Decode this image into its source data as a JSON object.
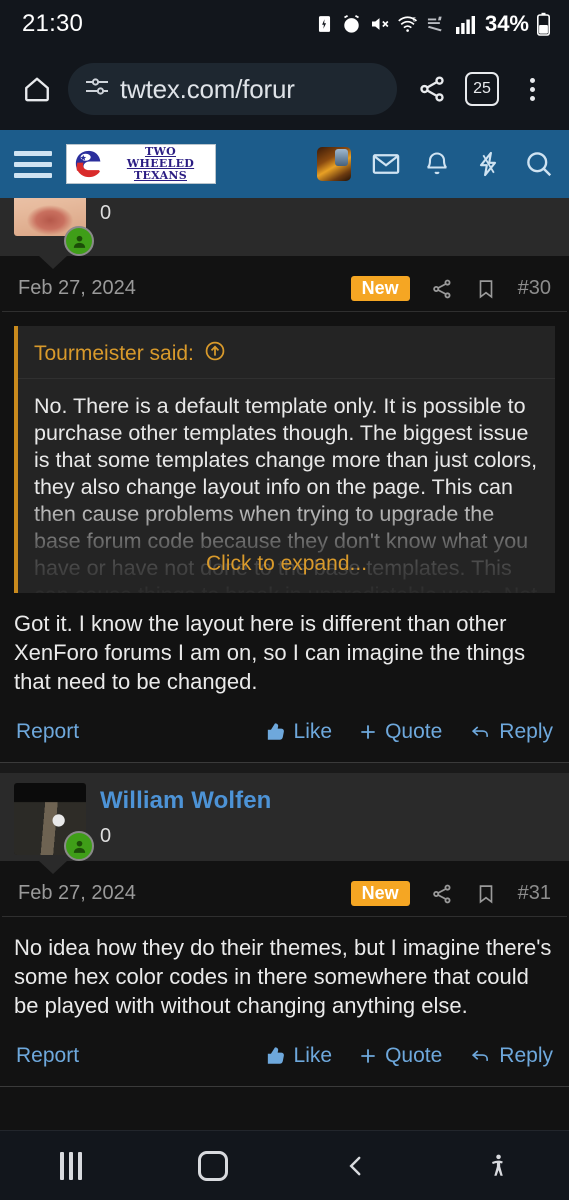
{
  "status_bar": {
    "time": "21:30",
    "battery_percent": "34%",
    "icons": [
      "battery-saver-icon",
      "alarm-icon",
      "mute-icon",
      "wifi-6-icon",
      "mobile-data-icon",
      "signal-bars-icon",
      "battery-icon"
    ]
  },
  "browser": {
    "home_icon": "home-icon",
    "url": "twtex.com/forur",
    "site_settings_icon": "site-settings-icon",
    "share_icon": "share-icon",
    "tab_count": "25",
    "menu_icon": "kebab-menu-icon"
  },
  "forum_header": {
    "menu_icon": "hamburger-menu-icon",
    "logo_line1": "TWO WHEELED",
    "logo_line2": "TEXANS",
    "icons": [
      "user-avatar-icon",
      "inbox-icon",
      "alerts-bell-icon",
      "whats-new-icon",
      "search-icon"
    ]
  },
  "posts": [
    {
      "author": "",
      "reaction_count": "0",
      "date": "Feb 27, 2024",
      "badge": "New",
      "number": "#30",
      "share_icon": "share-icon",
      "bookmark_icon": "bookmark-icon",
      "quote": {
        "header": "Tourmeister said:",
        "jump_icon": "jump-to-post-icon",
        "text": "No. There is a default template only. It is possible to purchase other templates though. The biggest issue is that some templates change more than just colors, they also change layout info on the page. This can then cause problems when trying to upgrade the base forum code because they don't know what you have or have not done to the base templates. This can cause things to break in unpredictable ways. Not being a coder myself, I have",
        "expand_label": "Click to expand..."
      },
      "body": "Got it. I know the layout here is different than other XenForo forums I am on, so I can imagine the things that need to be changed.",
      "actions": {
        "report": "Report",
        "like": "Like",
        "quote": "Quote",
        "reply": "Reply"
      }
    },
    {
      "author": "William Wolfen",
      "reaction_count": "0",
      "date": "Feb 27, 2024",
      "badge": "New",
      "number": "#31",
      "share_icon": "share-icon",
      "bookmark_icon": "bookmark-icon",
      "body": "No idea how they do their themes, but I imagine there's some hex color codes in there somewhere that could be played with without changing anything else.",
      "actions": {
        "report": "Report",
        "like": "Like",
        "quote": "Quote",
        "reply": "Reply"
      }
    }
  ],
  "nav_bar": {
    "recents_icon": "recents-icon",
    "home_icon": "home-button-icon",
    "back_icon": "back-icon",
    "accessibility_icon": "accessibility-icon"
  },
  "colors": {
    "header_blue": "#1c5c8b",
    "badge_orange": "#f5a623",
    "link_blue": "#6ea8dc",
    "username_blue": "#4d93d6",
    "quote_accent": "#c98a1d",
    "page_bg": "#121212"
  }
}
